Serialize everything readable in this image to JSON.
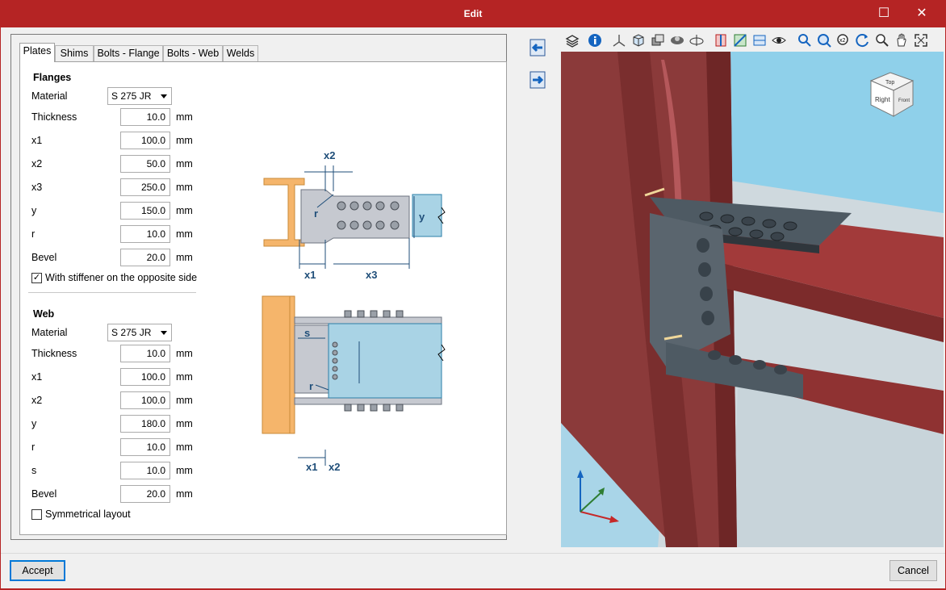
{
  "window": {
    "title": "Edit",
    "maximize_glyph": "☐",
    "close_glyph": "✕"
  },
  "tabs": [
    {
      "label": "Plates"
    },
    {
      "label": "Shims"
    },
    {
      "label": "Bolts - Flange"
    },
    {
      "label": "Bolts - Web"
    },
    {
      "label": "Welds"
    }
  ],
  "flanges": {
    "title": "Flanges",
    "material_label": "Material",
    "material_value": "S 275 JR",
    "rows": [
      {
        "label": "Thickness",
        "value": "10.0",
        "unit": "mm"
      },
      {
        "label": "x1",
        "value": "100.0",
        "unit": "mm"
      },
      {
        "label": "x2",
        "value": "50.0",
        "unit": "mm"
      },
      {
        "label": "x3",
        "value": "250.0",
        "unit": "mm"
      },
      {
        "label": "y",
        "value": "150.0",
        "unit": "mm"
      },
      {
        "label": "r",
        "value": "10.0",
        "unit": "mm"
      },
      {
        "label": "Bevel",
        "value": "20.0",
        "unit": "mm"
      }
    ],
    "stiffener_label": "With stiffener on the opposite side",
    "stiffener_checked": true
  },
  "web": {
    "title": "Web",
    "material_label": "Material",
    "material_value": "S 275 JR",
    "rows": [
      {
        "label": "Thickness",
        "value": "10.0",
        "unit": "mm"
      },
      {
        "label": "x1",
        "value": "100.0",
        "unit": "mm"
      },
      {
        "label": "x2",
        "value": "100.0",
        "unit": "mm"
      },
      {
        "label": "y",
        "value": "180.0",
        "unit": "mm"
      },
      {
        "label": "r",
        "value": "10.0",
        "unit": "mm"
      },
      {
        "label": "s",
        "value": "10.0",
        "unit": "mm"
      },
      {
        "label": "Bevel",
        "value": "20.0",
        "unit": "mm"
      }
    ],
    "symmetrical_label": "Symmetrical layout",
    "symmetrical_checked": false
  },
  "diagram_labels": {
    "top_x2": "x2",
    "top_r": "r",
    "top_y": "y",
    "top_x1": "x1",
    "top_x3": "x3",
    "bot_s": "s",
    "bot_r": "r",
    "bot_x1": "x1",
    "bot_x2": "x2"
  },
  "viewcube": {
    "front": "Right",
    "top": "Top",
    "side": "Front"
  },
  "buttons": {
    "accept": "Accept",
    "cancel": "Cancel"
  },
  "colors": {
    "titlebar": "#b52424",
    "steel": "#8b3a3a",
    "plate": "#4a5560",
    "sky": "#8fd0ea",
    "accent": "#0078d7"
  }
}
